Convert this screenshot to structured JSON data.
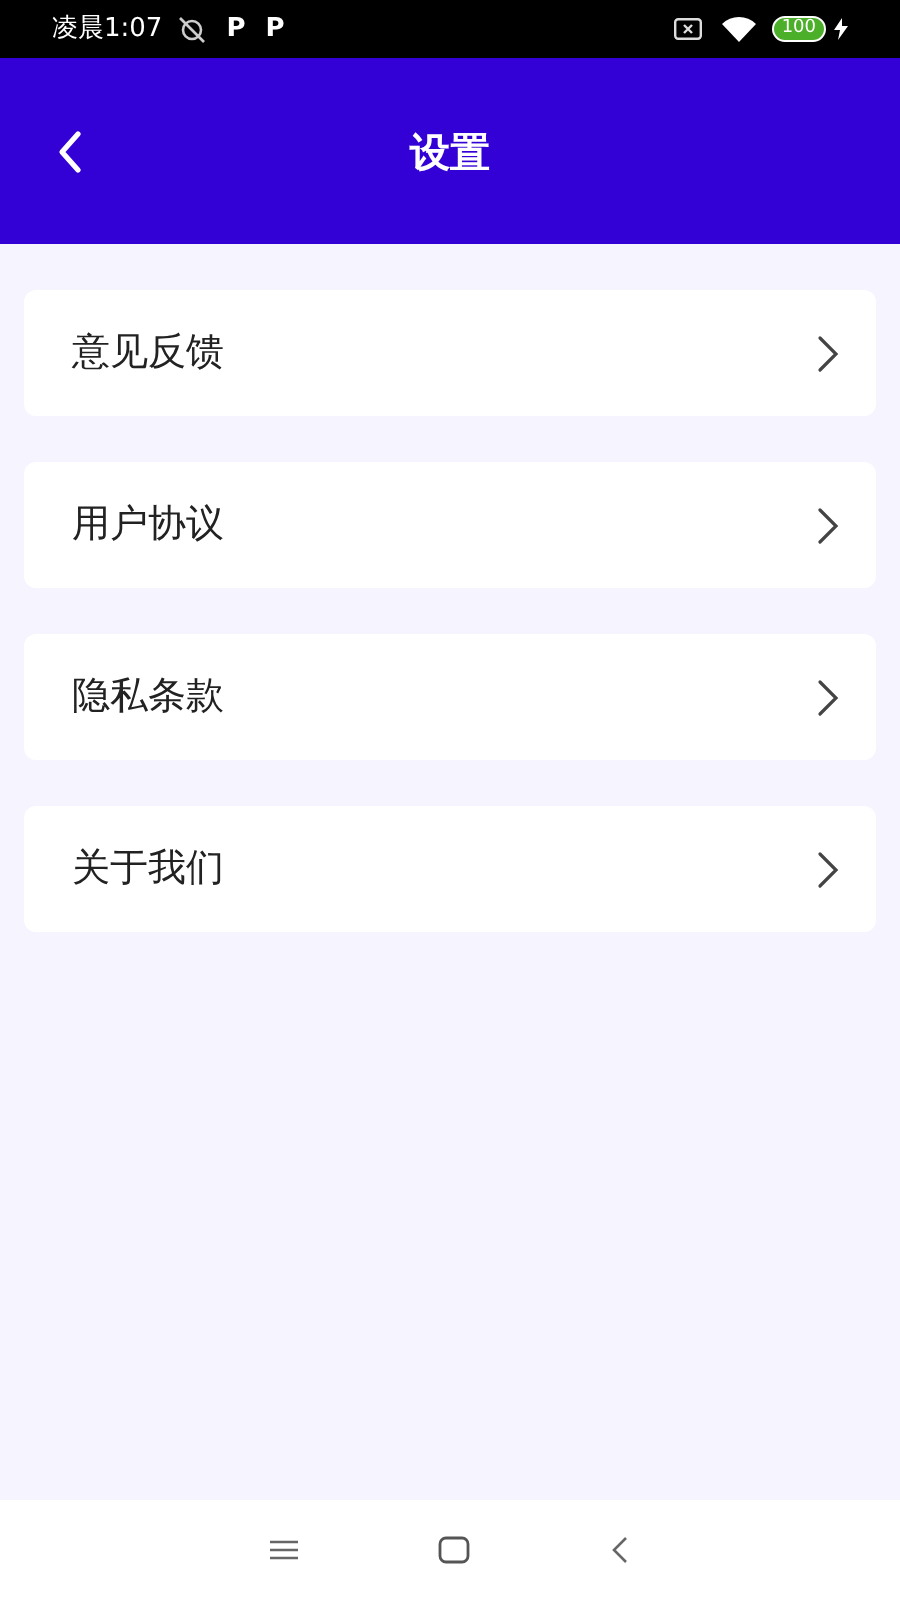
{
  "status_bar": {
    "time": "凌晨1:07",
    "notifications": [
      "P",
      "P"
    ],
    "battery": "100"
  },
  "header": {
    "title": "设置"
  },
  "menu_items": [
    {
      "label": "意见反馈"
    },
    {
      "label": "用户协议"
    },
    {
      "label": "隐私条款"
    },
    {
      "label": "关于我们"
    }
  ]
}
